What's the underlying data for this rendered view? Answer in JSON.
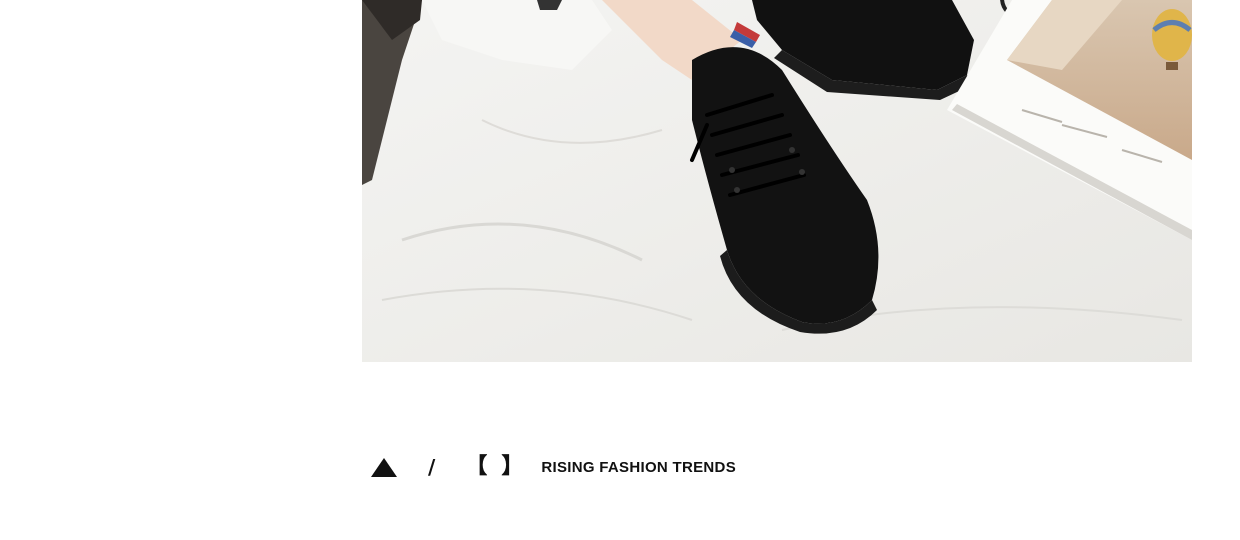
{
  "hero": {
    "image_name": "product-photo-black-sneakers"
  },
  "caption": {
    "icon": "triangle-up-icon",
    "separator": "/",
    "bracket_open": "【",
    "bracket_close": "】",
    "tagline": "RISING FASHION TRENDS"
  },
  "colors": {
    "text": "#111111",
    "background": "#ffffff"
  }
}
